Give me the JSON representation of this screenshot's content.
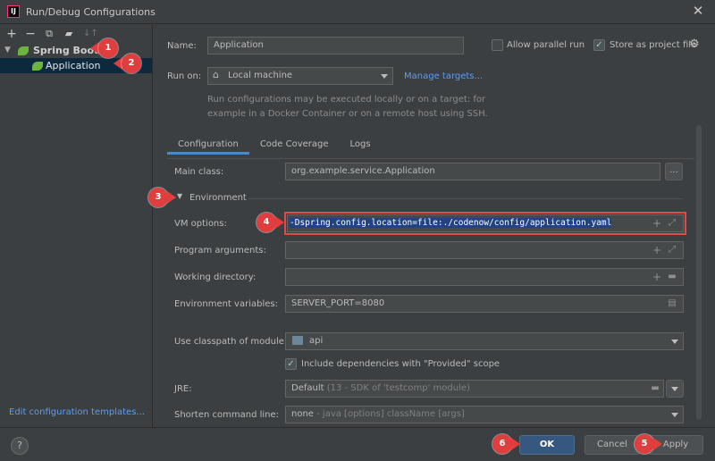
{
  "window": {
    "app_icon_text": "IJ",
    "title": "Run/Debug Configurations",
    "close_glyph": "✕"
  },
  "toolbar": {
    "add": "+",
    "remove": "−",
    "copy": "⧉",
    "folder": "▰",
    "sort": "↓↑"
  },
  "tree": {
    "spring_boot": "Spring Boot",
    "application": "Application"
  },
  "left": {
    "edit_templates": "Edit configuration templates..."
  },
  "form": {
    "name_label": "Name:",
    "name_value": "Application",
    "allow_parallel": "Allow parallel run",
    "store_project": "Store as project file",
    "run_on_label": "Run on:",
    "run_on_value": "Local machine",
    "manage_targets": "Manage targets...",
    "hint_line1": "Run configurations may be executed locally or on a target: for",
    "hint_line2": "example in a Docker Container or on a remote host using SSH."
  },
  "tabs": [
    "Configuration",
    "Code Coverage",
    "Logs"
  ],
  "config": {
    "main_class_label": "Main class:",
    "main_class_value": "org.example.service.Application",
    "browse": "...",
    "environment_label": "Environment",
    "vm_options_label": "VM options:",
    "vm_options_value": "-Dspring.config.location=file:./codenow/config/application.yaml",
    "program_args_label": "Program arguments:",
    "working_dir_label": "Working directory:",
    "env_vars_label": "Environment variables:",
    "env_vars_value": "SERVER_PORT=8080",
    "classpath_label": "Use classpath of module:",
    "classpath_value": "api",
    "include_deps": "Include dependencies with \"Provided\" scope",
    "jre_label": "JRE:",
    "jre_value": "Default",
    "jre_hint": "(13 - SDK of 'testcomp' module)",
    "shorten_label": "Shorten command line:",
    "shorten_value": "none",
    "shorten_hint": "- java [options] className [args]"
  },
  "buttons": {
    "help": "?",
    "ok": "OK",
    "cancel": "Cancel",
    "apply": "Apply"
  },
  "callouts": [
    "1",
    "2",
    "3",
    "4",
    "5",
    "6"
  ],
  "colors": {
    "background": "#3c3f41",
    "accent": "#4a88c7",
    "selection": "#0d293e",
    "callout": "#e03e3e",
    "spring": "#6db33f"
  }
}
